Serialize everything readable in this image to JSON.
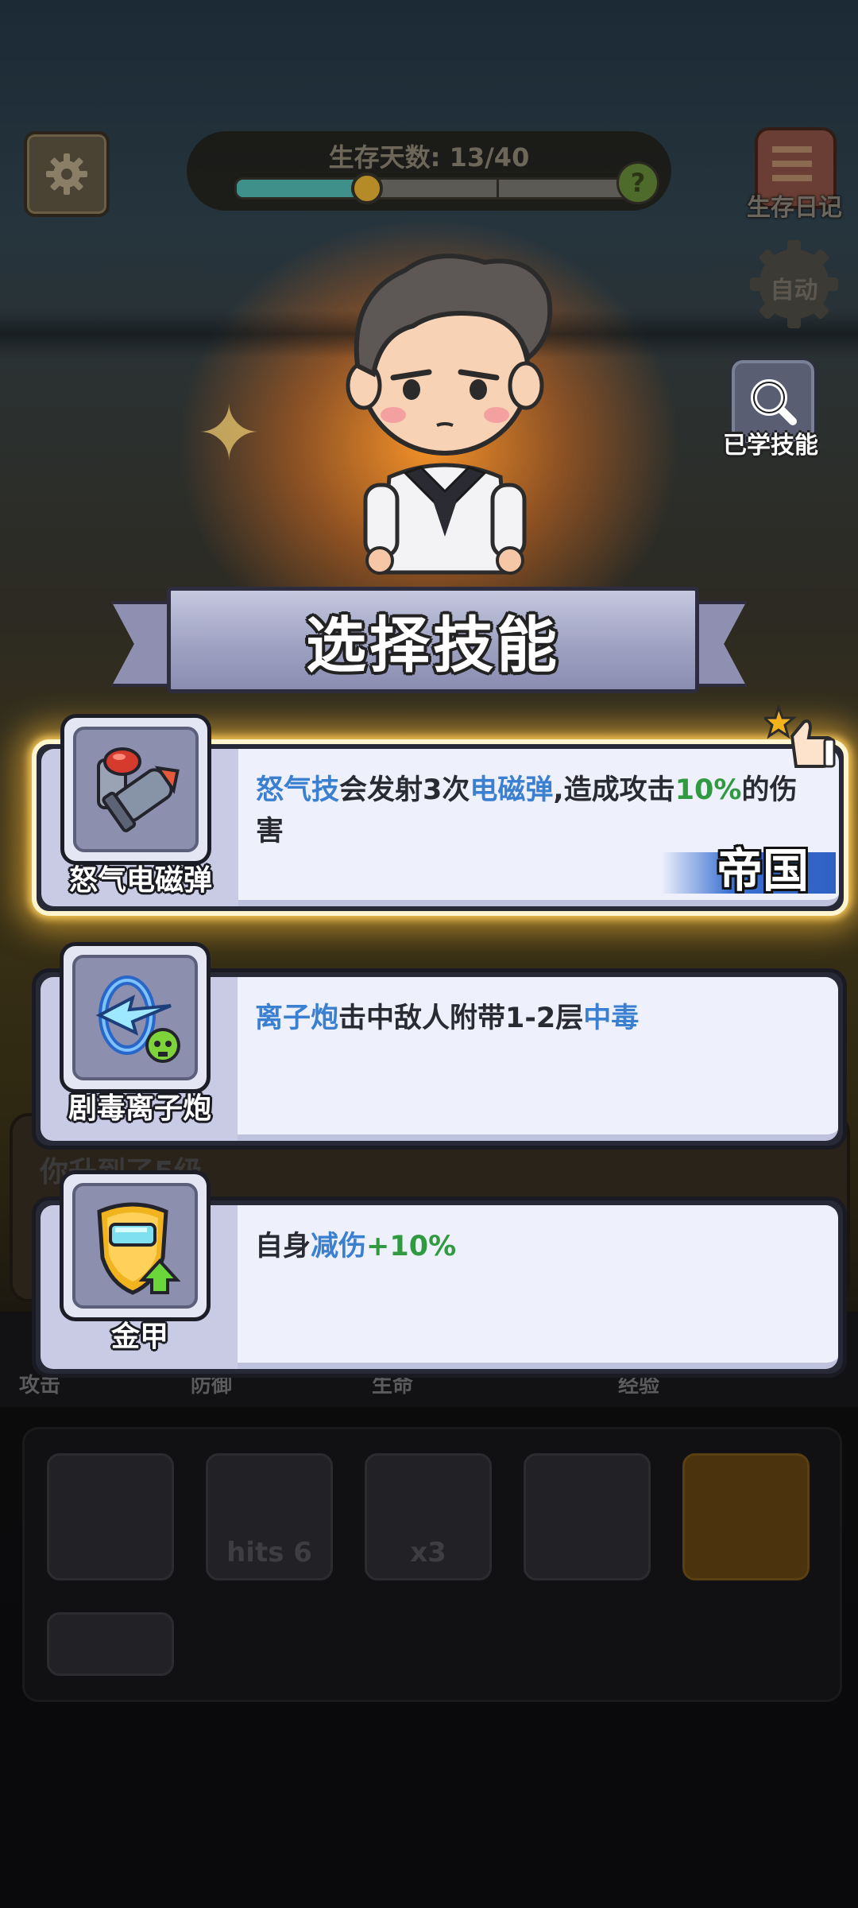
{
  "hud": {
    "survival_label": "生存天数: 13/40",
    "survival_progress": 0.325,
    "help_icon": "?",
    "diary_label": "生存日记",
    "auto_label": "自动",
    "learned_skills_label": "已学技能"
  },
  "banner": {
    "title": "选择技能"
  },
  "skills": [
    {
      "name": "怒气电磁弹",
      "desc_parts": [
        {
          "text": "怒气技",
          "color": "blue"
        },
        {
          "text": "会发射3次",
          "color": "dark"
        },
        {
          "text": "电磁弹",
          "color": "blue"
        },
        {
          "text": ",造成攻击",
          "color": "dark"
        },
        {
          "text": "10%",
          "color": "green"
        },
        {
          "text": "的伤害",
          "color": "dark"
        }
      ],
      "faction": "帝国",
      "selected": true,
      "icon": "electromagnetic-missile-icon"
    },
    {
      "name": "剧毒离子炮",
      "desc_parts": [
        {
          "text": "离子炮",
          "color": "blue"
        },
        {
          "text": "击中敌人附带1-2层",
          "color": "dark"
        },
        {
          "text": "中毒",
          "color": "blue"
        }
      ],
      "faction": "",
      "selected": false,
      "icon": "poison-ion-cannon-icon"
    },
    {
      "name": "金甲",
      "desc_parts": [
        {
          "text": "自身",
          "color": "dark"
        },
        {
          "text": "减伤",
          "color": "blue"
        },
        {
          "text": "+10%",
          "color": "green"
        }
      ],
      "faction": "",
      "selected": false,
      "icon": "golden-armor-icon"
    }
  ],
  "background": {
    "faded_message": "你升到了5级",
    "stat_tabs": [
      "攻击",
      "防御",
      "生命",
      "经验"
    ],
    "slot_labels": [
      "",
      "hits 6",
      "x3",
      "",
      ""
    ]
  },
  "colors": {
    "keyword_blue": "#3a7fd0",
    "value_green": "#2f9a40",
    "faction_blue": "#3a70d2"
  }
}
